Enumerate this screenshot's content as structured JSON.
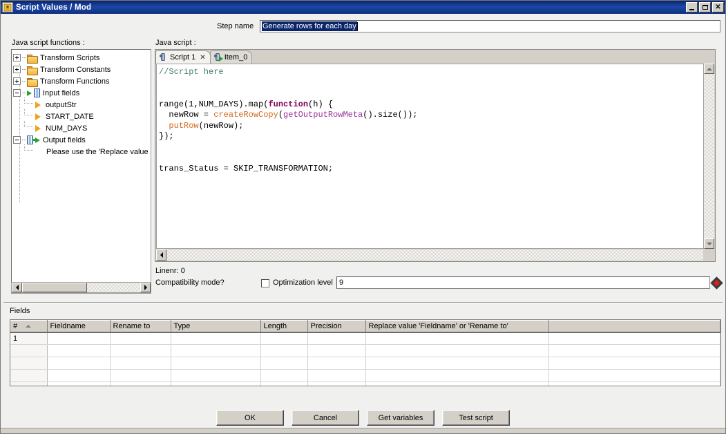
{
  "window": {
    "title": "Script Values / Mod",
    "icon": "script-values-icon",
    "minimize_label": "_",
    "maximize_label": "□",
    "close_label": "×"
  },
  "step": {
    "label": "Step name",
    "value": "Generate rows for each day",
    "selected": true
  },
  "left_panel": {
    "label": "Java script functions :",
    "tree": [
      {
        "label": "Transform Scripts",
        "icon": "folder-icon",
        "expander": "plus",
        "level": 0
      },
      {
        "label": "Transform Constants",
        "icon": "folder-icon",
        "expander": "plus",
        "level": 0
      },
      {
        "label": "Transform Functions",
        "icon": "folder-icon",
        "expander": "plus",
        "level": 0
      },
      {
        "label": "Input fields",
        "icon": "input-fields-icon",
        "expander": "minus",
        "level": 0
      },
      {
        "label": "outputStr",
        "icon": "field-arrow-icon",
        "expander": "none",
        "level": 1
      },
      {
        "label": "START_DATE",
        "icon": "field-arrow-icon",
        "expander": "none",
        "level": 1
      },
      {
        "label": "NUM_DAYS",
        "icon": "field-arrow-icon",
        "expander": "none",
        "level": 1
      },
      {
        "label": "Output fields",
        "icon": "output-fields-icon",
        "expander": "minus",
        "level": 0
      },
      {
        "label": "Please use the 'Replace value",
        "icon": "none",
        "expander": "none",
        "level": 2
      }
    ]
  },
  "editor": {
    "label": "Java script :",
    "tabs": [
      {
        "label": "Script 1",
        "active": true,
        "closable": true,
        "icon": "script-tab-icon",
        "close_label": "✕"
      },
      {
        "label": "Item_0",
        "active": false,
        "closable": false,
        "icon": "script-run-icon"
      }
    ],
    "code_lines": [
      {
        "text": "//Script here",
        "style": "comment"
      },
      {
        "text": "",
        "style": "plain"
      },
      {
        "text": "",
        "style": "plain"
      },
      {
        "text": "range(1,NUM_DAYS).map(function(h) {",
        "style": "mixed"
      },
      {
        "text": "  newRow = createRowCopy(getOutputRowMeta().size());",
        "style": "mixed"
      },
      {
        "text": "  putRow(newRow);",
        "style": "mixed"
      },
      {
        "text": "});",
        "style": "plain"
      },
      {
        "text": "",
        "style": "plain"
      },
      {
        "text": "",
        "style": "plain"
      },
      {
        "text": "trans_Status = SKIP_TRANSFORMATION;",
        "style": "plain"
      }
    ],
    "linenr_label": "Linenr: 0",
    "compatibility_label": "Compatibility mode?",
    "compatibility_checked": false,
    "optimization_label": "Optimization level",
    "optimization_value": "9",
    "variable_icon": "variable-diamond-icon"
  },
  "fields": {
    "label": "Fields",
    "columns": [
      {
        "label": "#",
        "sorted": true
      },
      {
        "label": "Fieldname"
      },
      {
        "label": "Rename to"
      },
      {
        "label": "Type"
      },
      {
        "label": "Length"
      },
      {
        "label": "Precision"
      },
      {
        "label": "Replace value 'Fieldname' or 'Rename to'"
      },
      {
        "label": ""
      }
    ],
    "rows": [
      {
        "num": "1",
        "fieldname": "",
        "rename_to": "",
        "type": "",
        "length": "",
        "precision": "",
        "replace": "",
        "extra": ""
      },
      {
        "num": "",
        "fieldname": "",
        "rename_to": "",
        "type": "",
        "length": "",
        "precision": "",
        "replace": "",
        "extra": ""
      },
      {
        "num": "",
        "fieldname": "",
        "rename_to": "",
        "type": "",
        "length": "",
        "precision": "",
        "replace": "",
        "extra": ""
      },
      {
        "num": "",
        "fieldname": "",
        "rename_to": "",
        "type": "",
        "length": "",
        "precision": "",
        "replace": "",
        "extra": ""
      },
      {
        "num": "",
        "fieldname": "",
        "rename_to": "",
        "type": "",
        "length": "",
        "precision": "",
        "replace": "",
        "extra": ""
      }
    ]
  },
  "buttons": {
    "ok": "OK",
    "cancel": "Cancel",
    "get_variables": "Get variables",
    "test_script": "Test script"
  },
  "colors": {
    "titlebar": "#0a246a",
    "face": "#d4d0c8",
    "comment": "#3f7f5f",
    "keyword": "#7f0055",
    "fn_orange": "#d2691e",
    "fn_purple": "#9b30a0",
    "selection": "#0a246a",
    "accent_red": "#cf2222"
  }
}
